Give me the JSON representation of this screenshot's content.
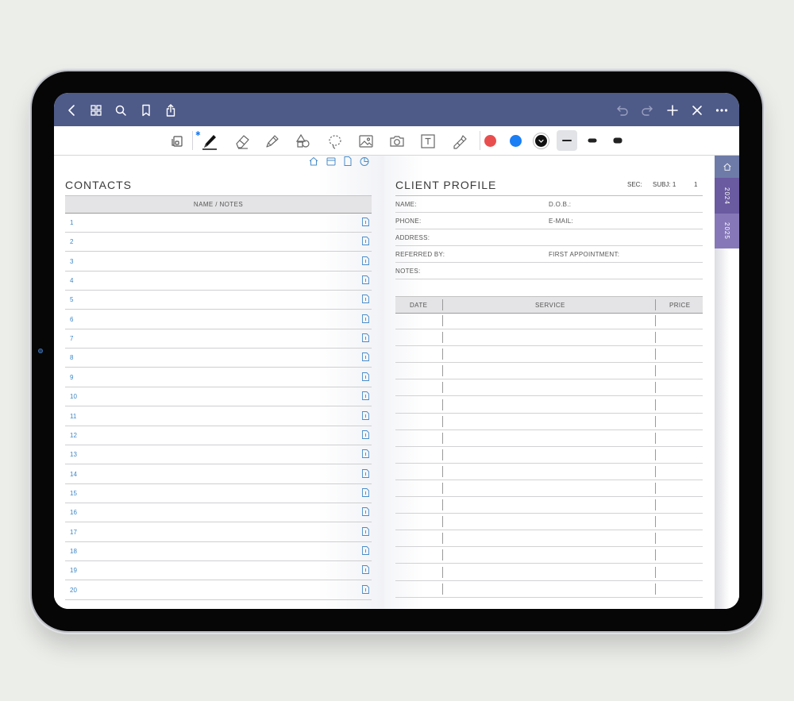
{
  "toolbar": {
    "colors": [
      "#e94e4e",
      "#1a7ef5",
      "#111111"
    ],
    "bluetooth_glyph": "✱"
  },
  "left_page": {
    "title": "CONTACTS",
    "column_header": "NAME / NOTES",
    "rows": [
      "1",
      "2",
      "3",
      "4",
      "5",
      "6",
      "7",
      "8",
      "9",
      "10",
      "11",
      "12",
      "13",
      "14",
      "15",
      "16",
      "17",
      "18",
      "19",
      "20"
    ]
  },
  "right_page": {
    "title": "CLIENT PROFILE",
    "sec_label": "SEC:",
    "subj_label": "SUBJ: 1",
    "page_num": "1",
    "fields": {
      "name": "NAME:",
      "dob": "D.O.B.:",
      "phone": "PHONE:",
      "email": "E-MAIL:",
      "address": "ADDRESS:",
      "referred_by": "REFERRED BY:",
      "first_appointment": "FIRST APPOINTMENT:",
      "notes": "NOTES:"
    },
    "table": {
      "headers": {
        "date": "DATE",
        "service": "SERVICE",
        "price": "PRICE"
      },
      "row_count": 17
    }
  },
  "side_tabs": {
    "tab_2024": "2024",
    "tab_2025": "2025"
  }
}
